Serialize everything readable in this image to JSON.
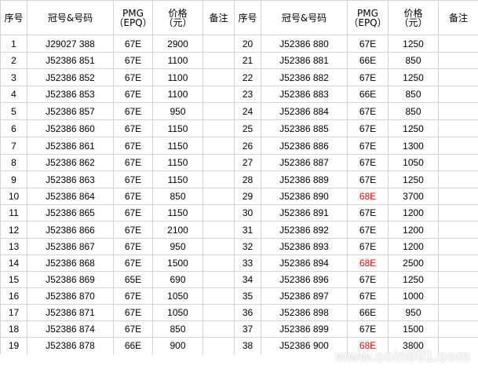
{
  "header": {
    "seq": "序号",
    "serial": "冠号&号码",
    "pmg_line1": "PMG",
    "pmg_line2": "（EPQ）",
    "price_line1": "价格",
    "price_line2": "（元）",
    "note": "备注"
  },
  "colors": {
    "serial": "#7a1a46",
    "price": "#ff0000",
    "pmg_68": "#ff0000",
    "grid": "#d4d4d4"
  },
  "rows": [
    {
      "left": {
        "no": "1",
        "serial": "J29027 388",
        "pmg": "67E",
        "price": "2900"
      },
      "right": {
        "no": "20",
        "serial": "J52386 880",
        "pmg": "67E",
        "price": "1250"
      }
    },
    {
      "left": {
        "no": "2",
        "serial": "J52386 851",
        "pmg": "67E",
        "price": "1100"
      },
      "right": {
        "no": "21",
        "serial": "J52386 881",
        "pmg": "66E",
        "price": "850"
      }
    },
    {
      "left": {
        "no": "3",
        "serial": "J52386 852",
        "pmg": "67E",
        "price": "1100"
      },
      "right": {
        "no": "22",
        "serial": "J52386 882",
        "pmg": "67E",
        "price": "1250"
      }
    },
    {
      "left": {
        "no": "4",
        "serial": "J52386 853",
        "pmg": "67E",
        "price": "1100"
      },
      "right": {
        "no": "23",
        "serial": "J52386 883",
        "pmg": "66E",
        "price": "850"
      }
    },
    {
      "left": {
        "no": "5",
        "serial": "J52386 857",
        "pmg": "67E",
        "price": "950"
      },
      "right": {
        "no": "24",
        "serial": "J52386 884",
        "pmg": "67E",
        "price": "850"
      }
    },
    {
      "left": {
        "no": "6",
        "serial": "J52386 860",
        "pmg": "67E",
        "price": "1150"
      },
      "right": {
        "no": "25",
        "serial": "J52386 885",
        "pmg": "67E",
        "price": "1250"
      }
    },
    {
      "left": {
        "no": "7",
        "serial": "J52386 861",
        "pmg": "67E",
        "price": "1150"
      },
      "right": {
        "no": "26",
        "serial": "J52386 886",
        "pmg": "67E",
        "price": "1300"
      }
    },
    {
      "left": {
        "no": "8",
        "serial": "J52386 862",
        "pmg": "67E",
        "price": "1150"
      },
      "right": {
        "no": "27",
        "serial": "J52386 887",
        "pmg": "67E",
        "price": "1050"
      }
    },
    {
      "left": {
        "no": "9",
        "serial": "J52386 863",
        "pmg": "67E",
        "price": "1150"
      },
      "right": {
        "no": "28",
        "serial": "J52386 889",
        "pmg": "67E",
        "price": "1250"
      }
    },
    {
      "left": {
        "no": "10",
        "serial": "J52386 864",
        "pmg": "67E",
        "price": "850"
      },
      "right": {
        "no": "29",
        "serial": "J52386 890",
        "pmg": "68E",
        "price": "3700"
      }
    },
    {
      "left": {
        "no": "11",
        "serial": "J52386 865",
        "pmg": "67E",
        "price": "1150"
      },
      "right": {
        "no": "30",
        "serial": "J52386 891",
        "pmg": "67E",
        "price": "1200"
      }
    },
    {
      "left": {
        "no": "12",
        "serial": "J52386 866",
        "pmg": "67E",
        "price": "2100"
      },
      "right": {
        "no": "31",
        "serial": "J52386 892",
        "pmg": "67E",
        "price": "1200"
      }
    },
    {
      "left": {
        "no": "13",
        "serial": "J52386 867",
        "pmg": "67E",
        "price": "950"
      },
      "right": {
        "no": "32",
        "serial": "J52386 893",
        "pmg": "67E",
        "price": "1200"
      }
    },
    {
      "left": {
        "no": "14",
        "serial": "J52386 868",
        "pmg": "67E",
        "price": "1500"
      },
      "right": {
        "no": "33",
        "serial": "J52386 894",
        "pmg": "68E",
        "price": "2500"
      }
    },
    {
      "left": {
        "no": "15",
        "serial": "J52386 869",
        "pmg": "65E",
        "price": "690"
      },
      "right": {
        "no": "34",
        "serial": "J52386 896",
        "pmg": "67E",
        "price": "1250"
      }
    },
    {
      "left": {
        "no": "16",
        "serial": "J52386 870",
        "pmg": "67E",
        "price": "1050"
      },
      "right": {
        "no": "35",
        "serial": "J52386 897",
        "pmg": "67E",
        "price": "1000"
      }
    },
    {
      "left": {
        "no": "17",
        "serial": "J52386 871",
        "pmg": "67E",
        "price": "1050"
      },
      "right": {
        "no": "36",
        "serial": "J52386 898",
        "pmg": "66E",
        "price": "950"
      }
    },
    {
      "left": {
        "no": "18",
        "serial": "J52386 874",
        "pmg": "67E",
        "price": "850"
      },
      "right": {
        "no": "37",
        "serial": "J52386 899",
        "pmg": "67E",
        "price": "1500"
      }
    },
    {
      "left": {
        "no": "19",
        "serial": "J52386 878",
        "pmg": "66E",
        "price": "900"
      },
      "right": {
        "no": "38",
        "serial": "J52386 900",
        "pmg": "68E",
        "price": "3800"
      }
    }
  ],
  "watermark": "www.coin001.com"
}
